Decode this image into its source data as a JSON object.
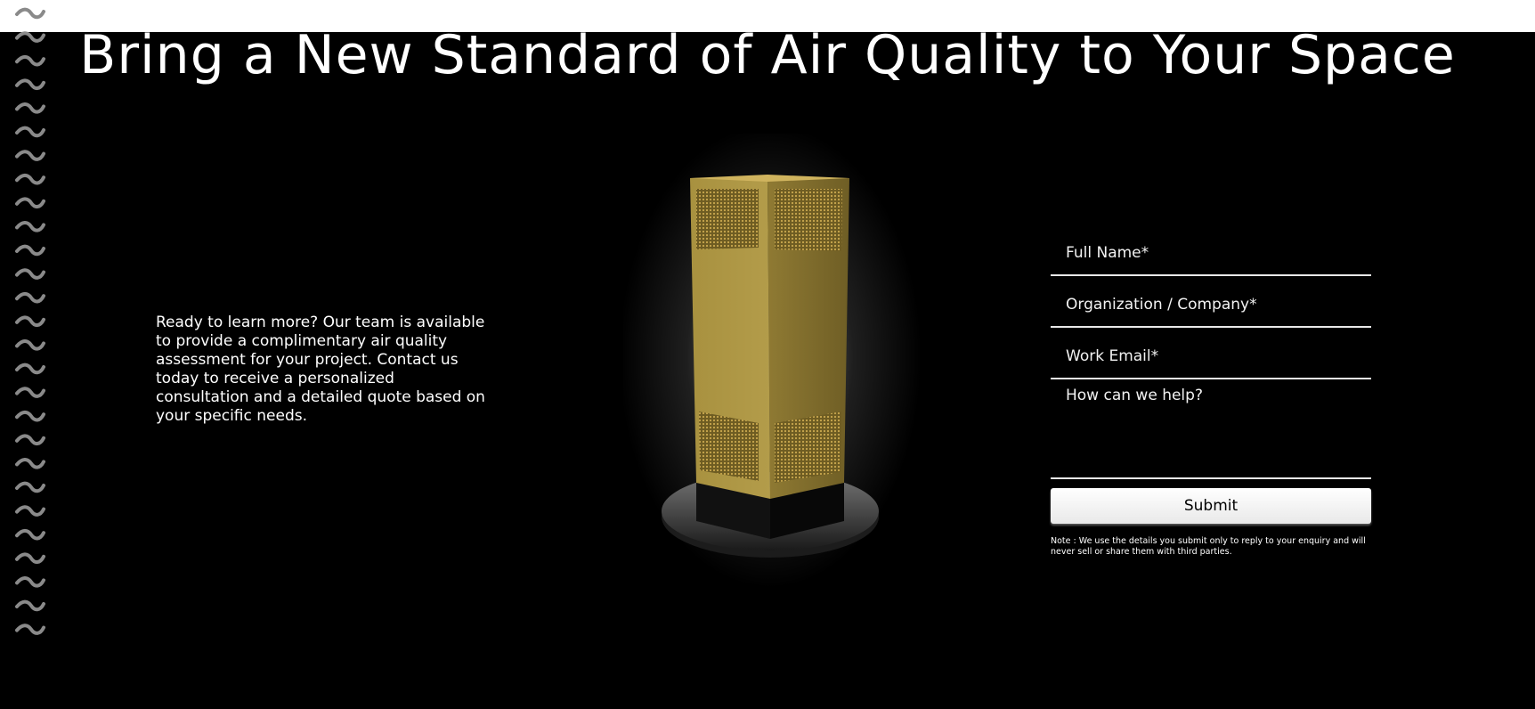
{
  "page": {
    "title": "Bring a New Standard of Air Quality to Your Space",
    "intro": "Ready to learn more? Our team is available to provide a complimentary air quality assessment for your project. Contact us today to receive a personalized consultation and a detailed quote based on your specific needs."
  },
  "form": {
    "full_name_placeholder": "Full Name*",
    "organization_placeholder": "Organization / Company*",
    "email_placeholder": "Work Email*",
    "message_placeholder": "How can we help?",
    "submit_label": "Submit",
    "note": "Note : We use the details you submit only to reply to your enquiry and will never sell or share them with third parties."
  },
  "colors": {
    "background": "#000000",
    "product_gold": "#b29a45",
    "field_line": "#e8e8e8"
  }
}
